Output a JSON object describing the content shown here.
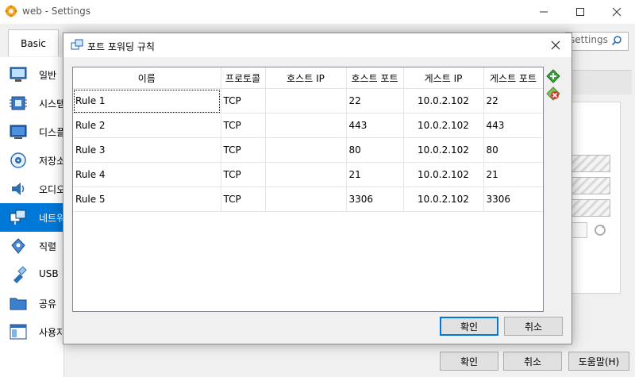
{
  "window": {
    "title": "web - Settings"
  },
  "toolbar": {
    "tab_basic": "Basic",
    "search_placeholder": "settings"
  },
  "sidebar": {
    "items": [
      {
        "label": "일반",
        "icon": "general-icon"
      },
      {
        "label": "시스템",
        "icon": "system-icon"
      },
      {
        "label": "디스플",
        "icon": "display-icon"
      },
      {
        "label": "저장소",
        "icon": "storage-icon"
      },
      {
        "label": "오디오",
        "icon": "audio-icon"
      },
      {
        "label": "네트워",
        "icon": "network-icon",
        "selected": true
      },
      {
        "label": "직렬",
        "icon": "serial-icon"
      },
      {
        "label": "USB",
        "icon": "usb-icon"
      },
      {
        "label": "공유",
        "icon": "shared-folder-icon"
      },
      {
        "label": "사용자",
        "icon": "user-interface-icon"
      }
    ]
  },
  "main_buttons": {
    "ok": "확인",
    "cancel": "취소",
    "help": "도움말(H)"
  },
  "dialog": {
    "title": "포트 포워딩 규칙",
    "columns": [
      "이름",
      "프로토콜",
      "호스트 IP",
      "호스트 포트",
      "게스트 IP",
      "게스트 포트"
    ],
    "rows": [
      [
        "Rule 1",
        "TCP",
        "",
        "22",
        "10.0.2.102",
        "22"
      ],
      [
        "Rule 2",
        "TCP",
        "",
        "443",
        "10.0.2.102",
        "443"
      ],
      [
        "Rule 3",
        "TCP",
        "",
        "80",
        "10.0.2.102",
        "80"
      ],
      [
        "Rule 4",
        "TCP",
        "",
        "21",
        "10.0.2.102",
        "21"
      ],
      [
        "Rule 5",
        "TCP",
        "",
        "3306",
        "10.0.2.102",
        "3306"
      ]
    ],
    "ok": "확인",
    "cancel": "취소"
  },
  "colors": {
    "accent": "#0078d7",
    "add_icon": "#3aa13a",
    "remove_icon": "#d9342b"
  }
}
